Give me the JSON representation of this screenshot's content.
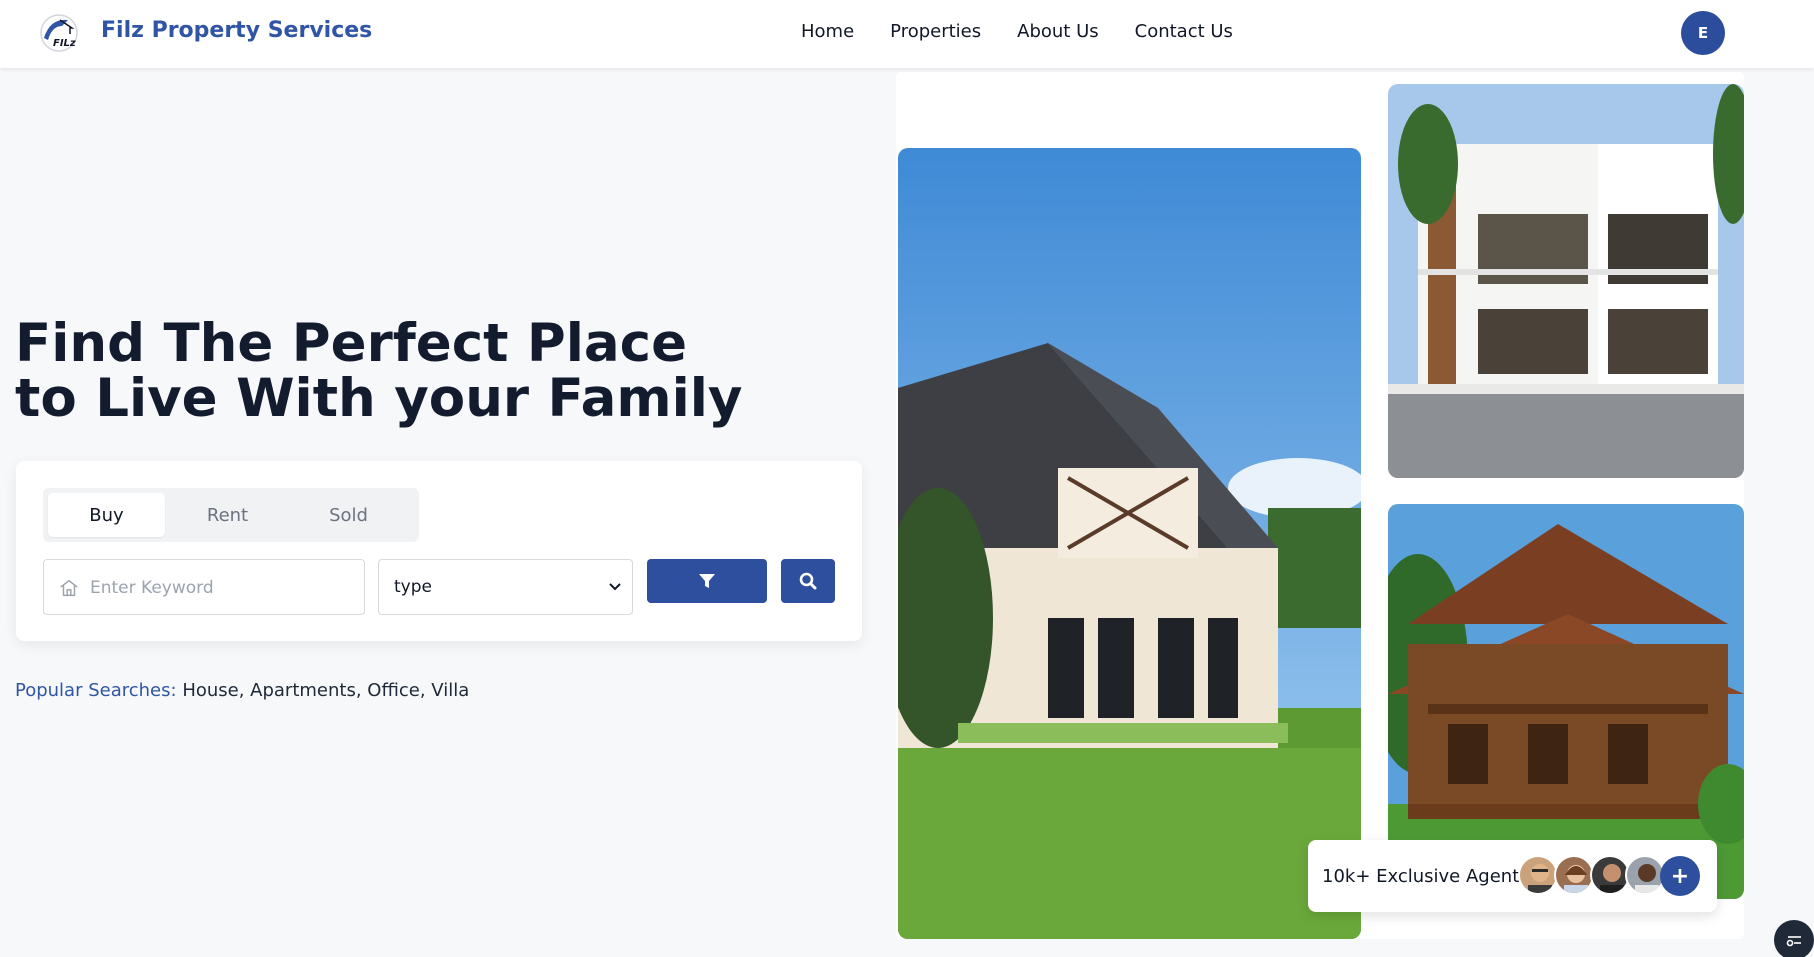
{
  "header": {
    "brand": "Filz Property Services",
    "logo_text": "FILz",
    "nav": [
      "Home",
      "Properties",
      "About Us",
      "Contact Us"
    ],
    "avatar_initial": "E"
  },
  "hero": {
    "title_line1": "Find The Perfect Place",
    "title_line2": "to Live With your Family"
  },
  "search": {
    "tabs": [
      "Buy",
      "Rent",
      "Sold"
    ],
    "active_tab": "Buy",
    "keyword_placeholder": "Enter Keyword",
    "type_selected": "type"
  },
  "popular": {
    "label": "Popular Searches:",
    "terms": "House, Apartments, Office, Villa"
  },
  "agents": {
    "label": "10k+ Exclusive Agents",
    "plus": "+"
  },
  "colors": {
    "brand_blue": "#2f55a4",
    "button_blue": "#2e4f9d",
    "heading": "#131b2e",
    "background": "#f7f8fa"
  }
}
